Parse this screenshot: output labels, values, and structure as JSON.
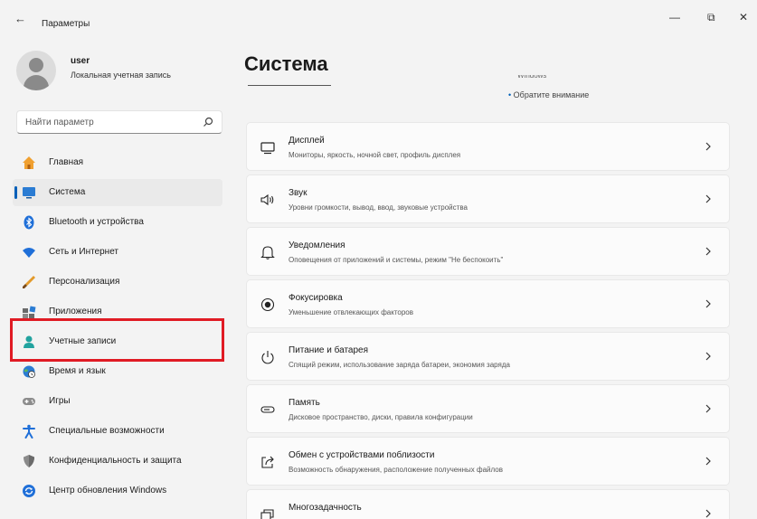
{
  "window": {
    "title": "Параметры",
    "back_glyph": "←",
    "minimize_glyph": "—",
    "maximize_glyph": "⧉",
    "close_glyph": "✕"
  },
  "profile": {
    "username": "user",
    "account_type": "Локальная учетная запись"
  },
  "search": {
    "placeholder": "Найти параметр",
    "value": ""
  },
  "sidebar": {
    "items": [
      {
        "label": "Главная",
        "icon": "home-icon"
      },
      {
        "label": "Система",
        "icon": "system-icon"
      },
      {
        "label": "Bluetooth и устройства",
        "icon": "bluetooth-icon"
      },
      {
        "label": "Сеть и Интернет",
        "icon": "wifi-icon"
      },
      {
        "label": "Персонализация",
        "icon": "brush-icon"
      },
      {
        "label": "Приложения",
        "icon": "apps-icon"
      },
      {
        "label": "Учетные записи",
        "icon": "accounts-icon"
      },
      {
        "label": "Время и язык",
        "icon": "globe-clock-icon"
      },
      {
        "label": "Игры",
        "icon": "gamepad-icon"
      },
      {
        "label": "Специальные возможности",
        "icon": "accessibility-icon"
      },
      {
        "label": "Конфиденциальность и защита",
        "icon": "shield-icon"
      },
      {
        "label": "Центр обновления Windows",
        "icon": "update-icon"
      }
    ],
    "selected_index": 1,
    "highlighted_index": 6
  },
  "main": {
    "title": "Система",
    "cut_text": "Windows",
    "attention_bullet": "•",
    "attention_text": "Обратите внимание",
    "cards": [
      {
        "title": "Дисплей",
        "desc": "Мониторы, яркость, ночной свет, профиль дисплея",
        "icon": "display-icon"
      },
      {
        "title": "Звук",
        "desc": "Уровни громкости, вывод, ввод, звуковые устройства",
        "icon": "speaker-icon"
      },
      {
        "title": "Уведомления",
        "desc": "Оповещения от приложений и системы, режим \"Не беспокоить\"",
        "icon": "bell-icon"
      },
      {
        "title": "Фокусировка",
        "desc": "Уменьшение отвлекающих факторов",
        "icon": "focus-icon"
      },
      {
        "title": "Питание и батарея",
        "desc": "Спящий режим, использование заряда батареи, экономия заряда",
        "icon": "power-icon"
      },
      {
        "title": "Память",
        "desc": "Дисковое пространство, диски, правила конфигурации",
        "icon": "storage-icon"
      },
      {
        "title": "Обмен с устройствами поблизости",
        "desc": "Возможность обнаружения, расположение полученных файлов",
        "icon": "share-icon"
      },
      {
        "title": "Многозадачность",
        "desc": "",
        "icon": "multitask-icon"
      }
    ]
  },
  "colors": {
    "accent": "#005fb8",
    "highlight_box": "#e01b24",
    "window_bg": "#f3f3f3",
    "card_bg": "#fbfbfb"
  }
}
